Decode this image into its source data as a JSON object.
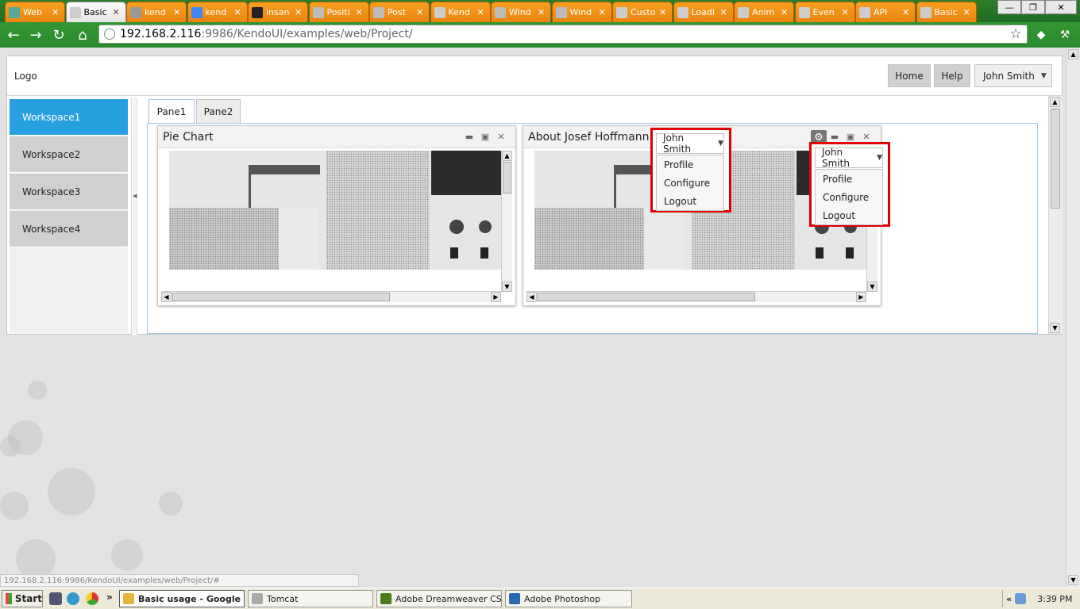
{
  "browser": {
    "tabs": [
      {
        "title": "Web",
        "active": false,
        "fav": "#5a9"
      },
      {
        "title": "Basic",
        "active": true,
        "fav": "#ccc"
      },
      {
        "title": "kend",
        "active": false,
        "fav": "#999"
      },
      {
        "title": "kend",
        "active": false,
        "fav": "#4285f4"
      },
      {
        "title": "insan",
        "active": false,
        "fav": "#222"
      },
      {
        "title": "Positi",
        "active": false,
        "fav": "#bbb"
      },
      {
        "title": "Post",
        "active": false,
        "fav": "#bbb"
      },
      {
        "title": "Kend",
        "active": false,
        "fav": "#ccc"
      },
      {
        "title": "Wind",
        "active": false,
        "fav": "#bbb"
      },
      {
        "title": "Wind",
        "active": false,
        "fav": "#bbb"
      },
      {
        "title": "Custo",
        "active": false,
        "fav": "#ccc"
      },
      {
        "title": "Loadi",
        "active": false,
        "fav": "#ccc"
      },
      {
        "title": "Anim",
        "active": false,
        "fav": "#ccc"
      },
      {
        "title": "Even",
        "active": false,
        "fav": "#ccc"
      },
      {
        "title": "API",
        "active": false,
        "fav": "#ccc"
      },
      {
        "title": "Basic",
        "active": false,
        "fav": "#ccc"
      }
    ],
    "address_host": "192.168.2.116",
    "address_path": ":9986/KendoUI/examples/web/Project/",
    "status_url": "192.168.2.116:9986/KendoUI/examples/web/Project/#"
  },
  "header": {
    "logo": "Logo",
    "home": "Home",
    "help": "Help",
    "user": "John Smith"
  },
  "sidebar": {
    "items": [
      {
        "label": "Workspace1",
        "active": true
      },
      {
        "label": "Workspace2",
        "active": false
      },
      {
        "label": "Workspace3",
        "active": false
      },
      {
        "label": "Workspace4",
        "active": false
      }
    ]
  },
  "panes": {
    "tabs": [
      {
        "label": "Pane1",
        "active": true
      },
      {
        "label": "Pane2",
        "active": false
      }
    ]
  },
  "windows": {
    "pie": {
      "title": "Pie Chart"
    },
    "about": {
      "title": "About Josef Hoffmann"
    }
  },
  "popups": {
    "user": "John Smith",
    "items": [
      "Profile",
      "Configure",
      "Logout"
    ]
  },
  "taskbar": {
    "start": "Start",
    "items": [
      {
        "label": "Basic usage - Google ...",
        "active": true,
        "color": "#e8b23a"
      },
      {
        "label": "Tomcat",
        "active": false,
        "color": "#aaa"
      },
      {
        "label": "Adobe Dreamweaver CS...",
        "active": false,
        "color": "#4a7a1a"
      },
      {
        "label": "Adobe Photoshop",
        "active": false,
        "color": "#2a6ab0"
      }
    ],
    "clock": "3:39 PM"
  }
}
